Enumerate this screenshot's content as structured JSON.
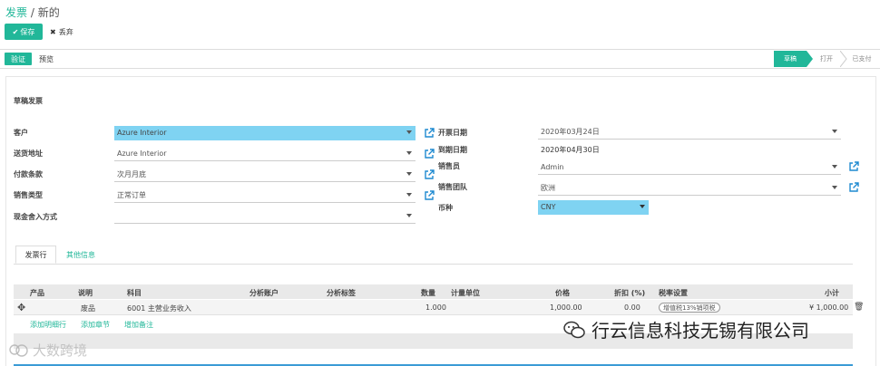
{
  "breadcrumb": {
    "root": "发票",
    "sep": " / ",
    "current": "新的"
  },
  "toolbar": {
    "save_label": "保存",
    "discard_label": "丢弃"
  },
  "actions": {
    "verify_label": "验证",
    "preview_label": "预览"
  },
  "status": {
    "draft": "草稿",
    "open": "打开",
    "paid": "已支付",
    "active": "草稿"
  },
  "form": {
    "title": "草稿发票",
    "left": [
      {
        "label": "客户",
        "value": "Azure Interior"
      },
      {
        "label": "送货地址",
        "value": "Azure Interior"
      },
      {
        "label": "付款条款",
        "value": "次月月底"
      },
      {
        "label": "销售类型",
        "value": "正常订单"
      },
      {
        "label": "现金舍入方式",
        "value": ""
      }
    ],
    "right": [
      {
        "label": "开票日期",
        "value": "2020年03月24日"
      },
      {
        "label": "到期日期",
        "value": "2020年04月30日"
      },
      {
        "label": "销售员",
        "value": "Admin"
      },
      {
        "label": "销售团队",
        "value": "欧洲"
      },
      {
        "label": "币种",
        "value": "CNY"
      }
    ]
  },
  "tabs": {
    "invoice_lines": "发票行",
    "other_info": "其他信息"
  },
  "table": {
    "headers": [
      "产品",
      "说明",
      "科目",
      "分析账户",
      "分析标签",
      "数量",
      "计量单位",
      "价格",
      "折扣 (%)",
      "税率设置",
      "小计"
    ],
    "row": {
      "description": "废品",
      "account": "6001 主营业务收入",
      "quantity": "1.000",
      "price": "1,000.00",
      "discount": "0.00",
      "tax": "增值税13%销项税",
      "subtotal": "¥ 1,000.00"
    },
    "add_links": [
      "添加明细行",
      "添加章节",
      "增加备注"
    ]
  },
  "watermarks": {
    "left": "大数跨境",
    "right": "行云信息科技无锡有限公司"
  },
  "colors": {
    "accent": "#21b799",
    "highlight": "#7fd3f2",
    "link_blue": "#1f8ad1"
  }
}
